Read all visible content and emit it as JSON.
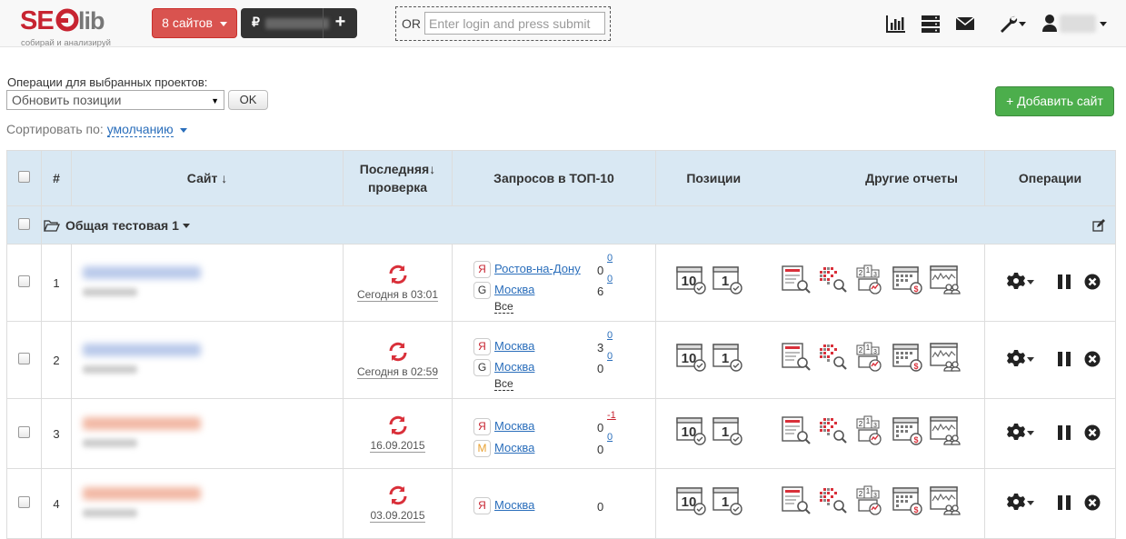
{
  "header": {
    "logo_text": "SEOlib",
    "logo_tagline": "собирай и анализируй",
    "sites_button": "8 сайтов",
    "currency_symbol": "₽",
    "add_balance_label": "+",
    "login_or": "OR",
    "login_placeholder": "Enter login and press submit",
    "icons": [
      "chart-bar-icon",
      "server-icon",
      "envelope-icon",
      "wrench-icon",
      "user-icon"
    ]
  },
  "operations": {
    "label": "Операции для выбранных проектов:",
    "selected": "Обновить позиции",
    "ok_label": "OK",
    "add_site_label": "+ Добавить сайт"
  },
  "sort": {
    "label": "Сортировать по:",
    "value": "умолчанию"
  },
  "table": {
    "headers": {
      "number": "#",
      "site": "Сайт ↓",
      "last_check": "Последняя↓ проверка",
      "top10": "Запросов в ТОП-10",
      "positions": "Позиции",
      "other_reports": "Другие отчеты",
      "operations": "Операции"
    },
    "group": {
      "name": "Общая тестовая 1"
    },
    "rows": [
      {
        "num": "1",
        "site_color": "#b9c9ea",
        "check_date": "Сегодня в 03:01",
        "regions": [
          {
            "engine": "Я",
            "engine_color": "#c72431",
            "city": "Ростов-на-Дону",
            "count": "0",
            "delta": "0"
          },
          {
            "engine": "G",
            "engine_color": "#333333",
            "city": "Москва",
            "count": "6",
            "delta": "0"
          }
        ],
        "all_label": "Все"
      },
      {
        "num": "2",
        "site_color": "#b9c9ea",
        "check_date": "Сегодня в 02:59",
        "regions": [
          {
            "engine": "Я",
            "engine_color": "#c72431",
            "city": "Москва",
            "count": "3",
            "delta": "0"
          },
          {
            "engine": "G",
            "engine_color": "#333333",
            "city": "Москва",
            "count": "0",
            "delta": "0"
          }
        ],
        "all_label": "Все"
      },
      {
        "num": "3",
        "site_color": "#f2b8a4",
        "check_date": "16.09.2015",
        "regions": [
          {
            "engine": "Я",
            "engine_color": "#c72431",
            "city": "Москва",
            "count": "0",
            "delta": "-1"
          },
          {
            "engine": "M",
            "engine_color": "#e8a030",
            "city": "Москва",
            "count": "0",
            "delta": "0"
          }
        ],
        "all_label": ""
      },
      {
        "num": "4",
        "site_color": "#f2b8a4",
        "check_date": "03.09.2015",
        "regions": [
          {
            "engine": "Я",
            "engine_color": "#c72431",
            "city": "Москва",
            "count": "0",
            "delta": ""
          }
        ],
        "all_label": ""
      }
    ],
    "position_icons": [
      "top10-calendar-icon",
      "top1-calendar-icon"
    ],
    "report_icons": [
      "report-search-icon",
      "heatmap-search-icon",
      "ranking-chart-icon",
      "budget-calendar-icon",
      "competitors-icon"
    ],
    "top10_label": "10",
    "top1_label": "1"
  },
  "colors": {
    "brand_red": "#c72431",
    "sites_button": "#d9534f",
    "add_site_button": "#4cae4c",
    "header_bg": "#d9e8f3",
    "link": "#2a6ebb",
    "refresh_red": "#d9303a"
  }
}
